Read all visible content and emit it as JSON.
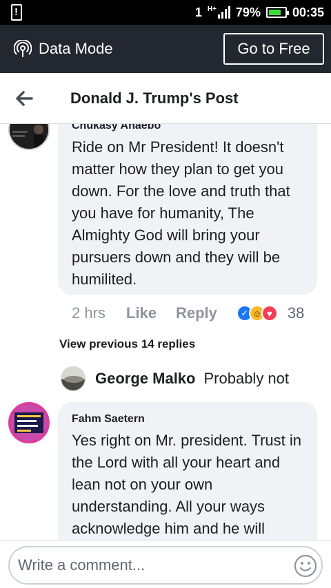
{
  "status_bar": {
    "network": "1",
    "signal_type": "H+",
    "battery_percent": "79%",
    "battery_level": 0.79,
    "time": "00:35"
  },
  "data_bar": {
    "label": "Data Mode",
    "go_free_label": "Go to Free"
  },
  "header": {
    "title": "Donald J. Trump's Post"
  },
  "comments": [
    {
      "author": "Chukasy Anaebo",
      "text": "Ride on Mr President! It doesn't matter how they plan to get you down. For the love and truth that you have for humanity, The Almighty God will bring your pursuers down and they will be humilited.",
      "time": "2 hrs",
      "like_label": "Like",
      "reply_label": "Reply",
      "reaction_count": "38"
    },
    {
      "author": "Fahm Saetern",
      "text": "Yes right on Mr. president. Trust in the Lord with all your heart and lean not on your own understanding. All your  ways acknowledge him and he will"
    }
  ],
  "view_previous": "View previous 14 replies",
  "reply_preview": {
    "author": "George Malko",
    "text": "Probably not"
  },
  "composer": {
    "placeholder": "Write a comment..."
  },
  "colors": {
    "status_bar": "#000000",
    "data_bar": "#23272f",
    "bubble": "#f0f2f5",
    "meta_text": "#8d949e",
    "like_blue": "#1877f2",
    "haha_yellow": "#f7b928",
    "love_red": "#f33e58"
  }
}
